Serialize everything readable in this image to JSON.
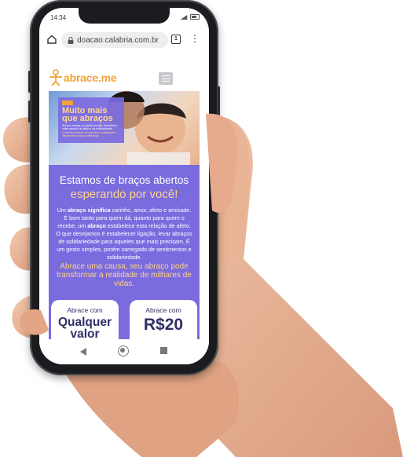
{
  "status_bar": {
    "time": "14:34"
  },
  "browser": {
    "url": "doacao.calabria.com.br",
    "tab_count": "1"
  },
  "site": {
    "logo_text": "abrace.me",
    "hero": {
      "title": "Muito mais que abraços",
      "body": "Abrace causas e projetos sociais, transforme vidas através do afeto e da solidariedade.",
      "link": "Contribua através de uma das modalidades disponíveis e faça a diferença!"
    },
    "headline_line1": "Estamos de braços abertos",
    "headline_line2": "esperando por você!",
    "paragraph": {
      "part1": "Um ",
      "bold1": "abraço significa",
      "part2": " carinho, amor, afeto e amizade. É bom tanto para quem dá, quanto para quem o recebe, um ",
      "bold2": "abraço",
      "part3": " estabelece esta relação de afeto. O que desejamos é estabelecer ligação, levar abraços de solidariedade para aqueles que mais precisam. É um gesto simples, porém carregado de sentimentos e solidariedade."
    },
    "cta": "Abrace uma causa, seu abraço pode transformar a realidade de milhares de vidas.",
    "cards": [
      {
        "caption": "Abrace com",
        "value": "Qualquer valor"
      },
      {
        "caption": "Abrace com",
        "value": "R$20"
      }
    ]
  },
  "colors": {
    "purple": "#7a6bdf",
    "orange": "#f4a236",
    "yellow": "#ffd48a",
    "navy": "#2f2e66"
  }
}
